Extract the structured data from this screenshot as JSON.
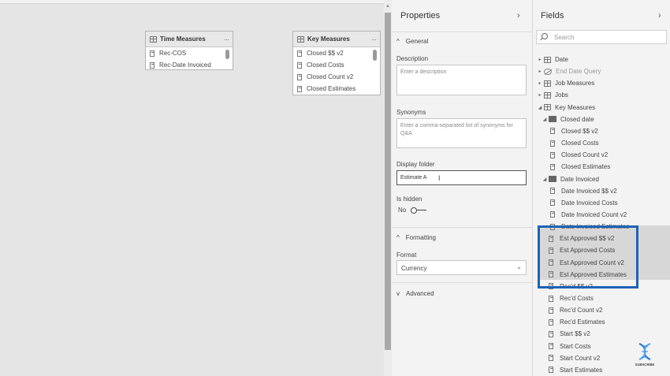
{
  "canvas": {
    "tables": [
      {
        "title": "Time Measures",
        "rows": [
          "Rec-COS",
          "Rec-Date Invoiced"
        ]
      },
      {
        "title": "Key Measures",
        "rows": [
          "Closed $$ v2",
          "Closed Costs",
          "Closed Count v2",
          "Closed Estimates"
        ]
      }
    ],
    "more_dots": "···"
  },
  "properties": {
    "title": "Properties",
    "chevron": "›",
    "general": {
      "label": "General",
      "chevron": "^"
    },
    "description": {
      "label": "Description",
      "placeholder": "Enter a description"
    },
    "synonyms": {
      "label": "Synonyms",
      "placeholder": "Enter a comma-separated list of synonyms for Q&A"
    },
    "display_folder": {
      "label": "Display folder",
      "value": "Estimate A"
    },
    "is_hidden": {
      "label": "Is hidden",
      "value": "No"
    },
    "formatting": {
      "label": "Formatting",
      "chevron": "^"
    },
    "format": {
      "label": "Format",
      "value": "Currency"
    },
    "advanced": {
      "label": "Advanced",
      "chevron": "v"
    }
  },
  "fields": {
    "title": "Fields",
    "chevron": "›",
    "search_placeholder": "Search",
    "items": [
      {
        "label": "Date",
        "type": "table",
        "expand": "▸",
        "level": 0
      },
      {
        "label": "End Date Query",
        "type": "hidden-table",
        "expand": "▸",
        "level": 0
      },
      {
        "label": "Job Measures",
        "type": "table",
        "expand": "▸",
        "level": 0
      },
      {
        "label": "Jobs",
        "type": "table",
        "expand": "▸",
        "level": 0
      },
      {
        "label": "Key Measures",
        "type": "table",
        "expand": "◢",
        "level": 0
      },
      {
        "label": "Closed date",
        "type": "folder",
        "expand": "◢",
        "level": 1
      },
      {
        "label": "Closed $$ v2",
        "type": "measure",
        "level": 2
      },
      {
        "label": "Closed Costs",
        "type": "measure",
        "level": 2
      },
      {
        "label": "Closed Count v2",
        "type": "measure",
        "level": 2
      },
      {
        "label": "Closed Estimates",
        "type": "measure",
        "level": 2
      },
      {
        "label": "Date Invoiced",
        "type": "folder",
        "expand": "◢",
        "level": 1
      },
      {
        "label": "Date Invoiced $$ v2",
        "type": "measure",
        "level": 2
      },
      {
        "label": "Date Invoiced Costs",
        "type": "measure",
        "level": 2
      },
      {
        "label": "Date Invoiced Count v2",
        "type": "measure",
        "level": 2
      },
      {
        "label": "Date Invoiced Estimates",
        "type": "measure",
        "level": 2
      },
      {
        "label": "Est Approved $$ v2",
        "type": "measure",
        "level": 1,
        "selected": true
      },
      {
        "label": "Est Approved Costs",
        "type": "measure",
        "level": 1,
        "selected": true
      },
      {
        "label": "Est Approved Count v2",
        "type": "measure",
        "level": 1,
        "selected": true
      },
      {
        "label": "Est Approved Estimates",
        "type": "measure",
        "level": 1,
        "selected": true
      },
      {
        "label": "Rec'd $$ v2",
        "type": "measure",
        "level": 1
      },
      {
        "label": "Rec'd Costs",
        "type": "measure",
        "level": 1
      },
      {
        "label": "Rec'd Count v2",
        "type": "measure",
        "level": 1
      },
      {
        "label": "Rec'd Estimates",
        "type": "measure",
        "level": 1
      },
      {
        "label": "Start $$ v2",
        "type": "measure",
        "level": 1
      },
      {
        "label": "Start Costs",
        "type": "measure",
        "level": 1
      },
      {
        "label": "Start Count v2",
        "type": "measure",
        "level": 1
      },
      {
        "label": "Start Estimates",
        "type": "measure",
        "level": 1
      }
    ]
  },
  "watermark": {
    "label": "SUBSCRIBE",
    "icon": "dna-icon"
  },
  "colors": {
    "highlight": "#1f62b3",
    "pane_bg": "#f3f3f3",
    "canvas_bg": "#e5e5e5"
  }
}
